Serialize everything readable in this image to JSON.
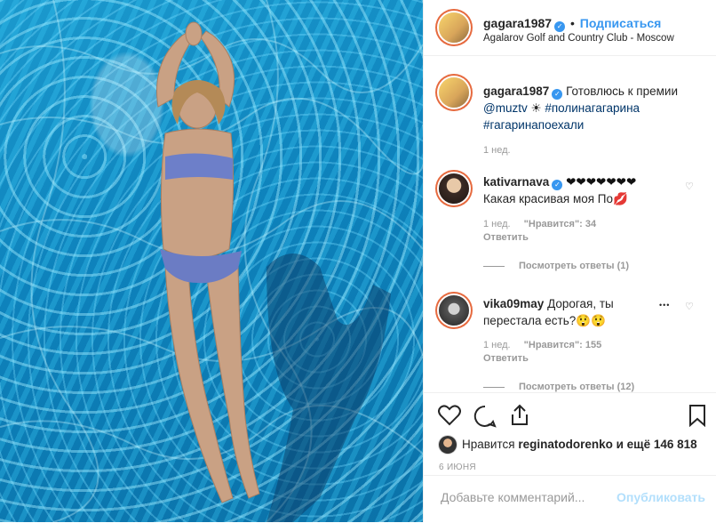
{
  "header": {
    "username": "gagara1987",
    "dot": "•",
    "follow_label": "Подписаться",
    "location": "Agalarov Golf and Country Club - Moscow"
  },
  "caption": {
    "username": "gagara1987",
    "text_1": "Готовлюсь к премии",
    "mention": "@muztv",
    "sun": "☀",
    "hashtag_1": "#полинагагарина",
    "hashtag_2": "#гагаринапоехали",
    "time": "1 нед."
  },
  "comments": [
    {
      "username": "kativarnava",
      "hearts": "❤❤❤❤❤❤❤",
      "text": "Какая красивая моя По💋",
      "time": "1 нед.",
      "likes": "\"Нравится\": 34",
      "reply": "Ответить",
      "view_replies": "Посмотреть ответы (1)"
    },
    {
      "username": "vika09may",
      "text": "Дорогая, ты перестала есть?😲😲",
      "more": "•••",
      "time": "1 нед.",
      "likes": "\"Нравится\": 155",
      "reply": "Ответить",
      "view_replies": "Посмотреть ответы (12)"
    }
  ],
  "likes": {
    "prefix": "Нравится",
    "user": "reginatodorenko",
    "suffix": "и ещё 146 818"
  },
  "date": "6 ИЮНЯ",
  "add_comment": {
    "placeholder": "Добавьте комментарий...",
    "post_label": "Опубликовать"
  },
  "colors": {
    "link": "#3897f0",
    "muted": "#999999",
    "pool_blue": "#1a9bd0"
  },
  "icons": [
    "verified-icon",
    "heart-icon",
    "comment-icon",
    "share-icon",
    "bookmark-icon",
    "more-icon"
  ]
}
